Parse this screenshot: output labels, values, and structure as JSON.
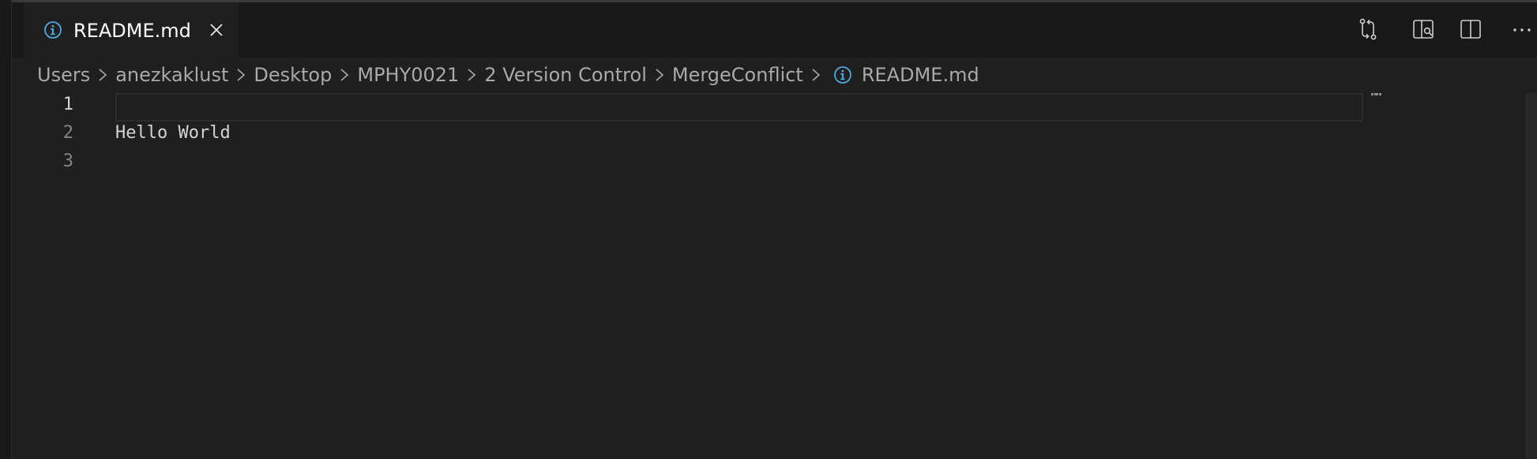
{
  "tab": {
    "label": "README.md",
    "icon": "info-icon",
    "close_icon": "close-icon"
  },
  "actions": [
    {
      "name": "compare-changes-icon"
    },
    {
      "name": "open-preview-to-side-icon"
    },
    {
      "name": "split-editor-icon"
    },
    {
      "name": "more-actions-icon"
    }
  ],
  "breadcrumbs": {
    "items": [
      "Users",
      "anezkaklust",
      "Desktop",
      "MPHY0021",
      "2 Version Control",
      "MergeConflict"
    ],
    "file": "README.md",
    "separator_icon": "chevron-right-icon"
  },
  "editor": {
    "line_numbers": [
      "1",
      "2",
      "3"
    ],
    "lines": [
      "",
      "Hello World",
      ""
    ],
    "active_line": 1
  },
  "colors": {
    "background": "#1f1f1f",
    "tabbar": "#181818",
    "info_icon": "#4fa9dc",
    "text": "#d4d4d4"
  }
}
